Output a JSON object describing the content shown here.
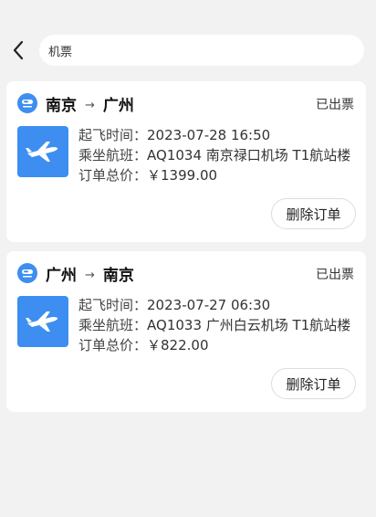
{
  "header": {
    "search_value": "机票"
  },
  "orders": [
    {
      "from": "南京",
      "arrow": "→",
      "to": "广州",
      "status": "已出票",
      "departure_label": "起飞时间：",
      "departure_value": "2023-07-28 16:50",
      "flight_label": "乘坐航班：",
      "flight_value": "AQ1034 南京禄口机场 T1航站楼",
      "price_label": "订单总价：",
      "price_value": "￥1399.00",
      "delete_label": "删除订单"
    },
    {
      "from": "广州",
      "arrow": "→",
      "to": "南京",
      "status": "已出票",
      "departure_label": "起飞时间：",
      "departure_value": "2023-07-27 06:30",
      "flight_label": "乘坐航班：",
      "flight_value": "AQ1033 广州白云机场 T1航站楼",
      "price_label": "订单总价：",
      "price_value": "￥822.00",
      "delete_label": "删除订单"
    }
  ],
  "colors": {
    "accent": "#3d8ef0",
    "background": "#f2f2f2",
    "card": "#ffffff"
  },
  "icons": {
    "back": "chevron-left-icon",
    "route": "train-icon",
    "ticket": "airplane-icon"
  }
}
